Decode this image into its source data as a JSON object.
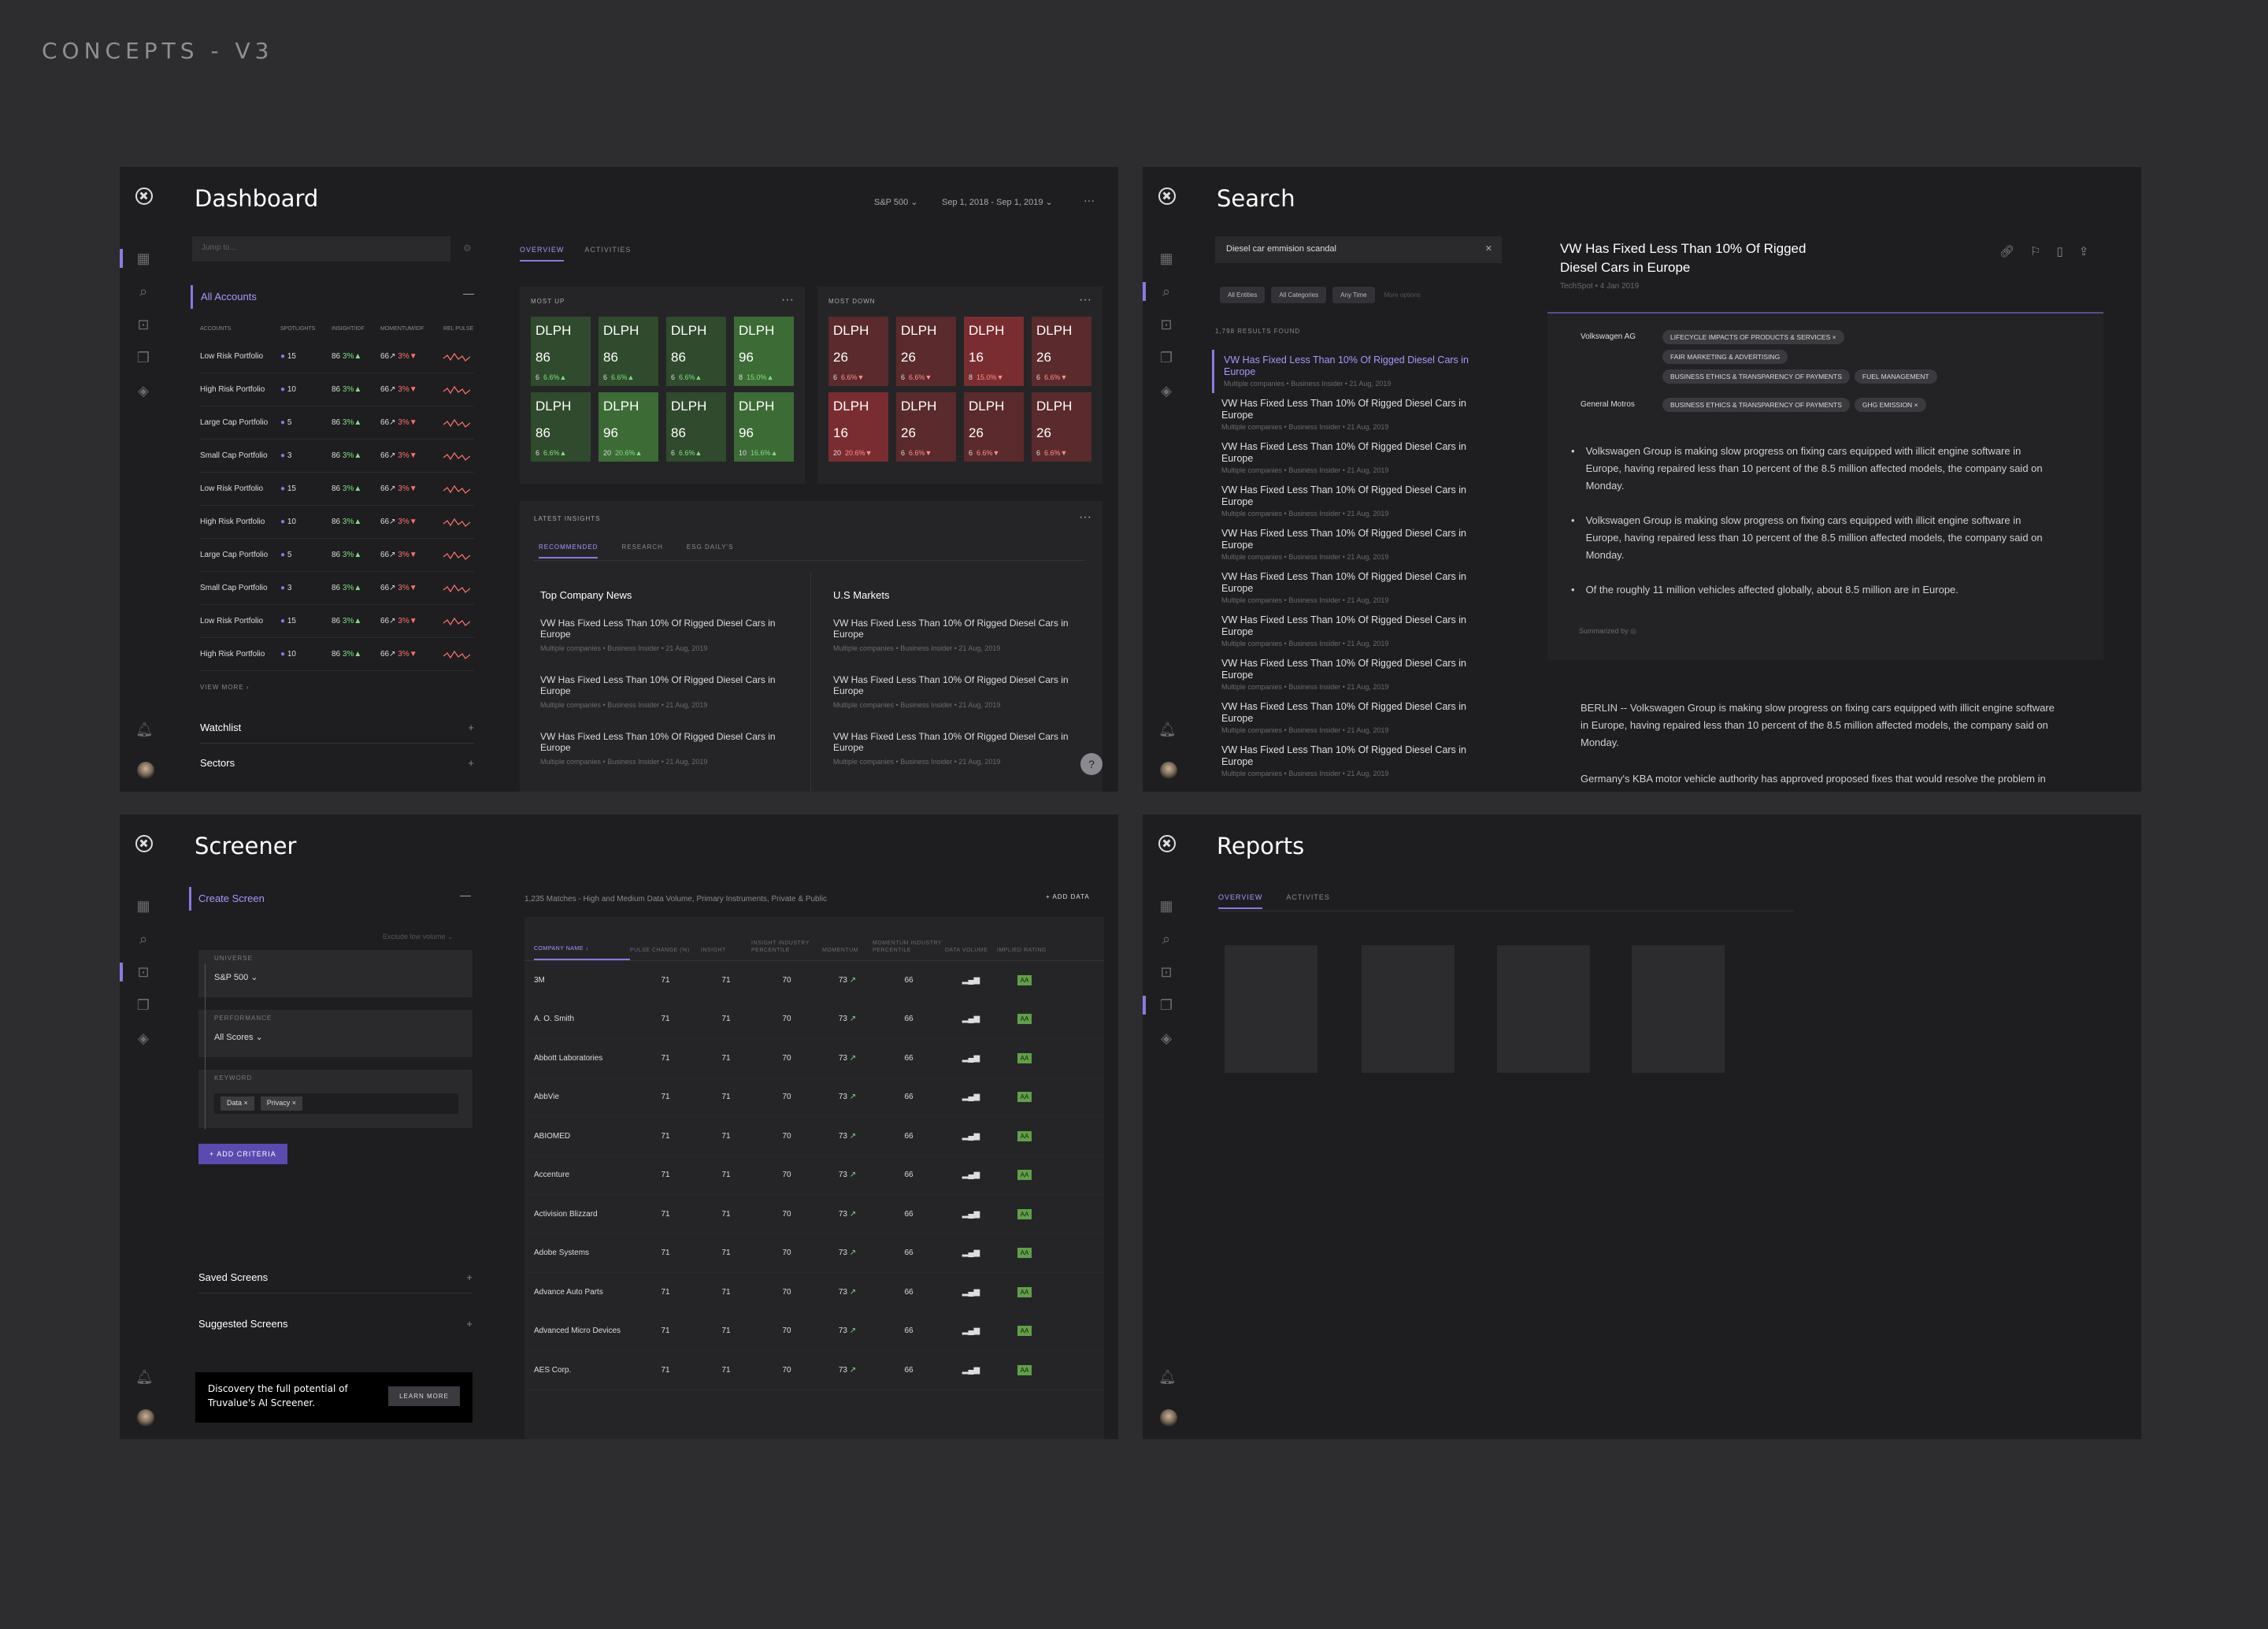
{
  "header": {
    "label": "CONCEPTS - V3"
  },
  "dashboard": {
    "title": "Dashboard",
    "index": "S&P 500",
    "date_range": "Sep 1, 2018 - Sep 1, 2019",
    "more": "···",
    "search_placeholder": "Jump to...",
    "all_accounts": "All Accounts",
    "columns": [
      "ACCOUNTS",
      "SPOTLIGHTS",
      "INSIGHT/IDF",
      "MOMENTUM/IDF",
      "REL PULSE"
    ],
    "accounts": [
      {
        "name": "Low Risk Portfolio",
        "spot": "15",
        "ins": "86",
        "insd": "3%",
        "mom": "66",
        "momd": "3%"
      },
      {
        "name": "High Risk Portfolio",
        "spot": "10",
        "ins": "86",
        "insd": "3%",
        "mom": "66",
        "momd": "3%"
      },
      {
        "name": "Large Cap Portfolio",
        "spot": "5",
        "ins": "86",
        "insd": "3%",
        "mom": "66",
        "momd": "3%"
      },
      {
        "name": "Small Cap Portfolio",
        "spot": "3",
        "ins": "86",
        "insd": "3%",
        "mom": "66",
        "momd": "3%"
      },
      {
        "name": "Low Risk Portfolio",
        "spot": "15",
        "ins": "86",
        "insd": "3%",
        "mom": "66",
        "momd": "3%"
      },
      {
        "name": "High Risk Portfolio",
        "spot": "10",
        "ins": "86",
        "insd": "3%",
        "mom": "66",
        "momd": "3%"
      },
      {
        "name": "Large Cap Portfolio",
        "spot": "5",
        "ins": "86",
        "insd": "3%",
        "mom": "66",
        "momd": "3%"
      },
      {
        "name": "Small Cap Portfolio",
        "spot": "3",
        "ins": "86",
        "insd": "3%",
        "mom": "66",
        "momd": "3%"
      },
      {
        "name": "Low Risk Portfolio",
        "spot": "15",
        "ins": "86",
        "insd": "3%",
        "mom": "66",
        "momd": "3%"
      },
      {
        "name": "High Risk Portfolio",
        "spot": "10",
        "ins": "86",
        "insd": "3%",
        "mom": "66",
        "momd": "3%"
      }
    ],
    "view_more": "VIEW MORE",
    "watchlist": "Watchlist",
    "sectors": "Sectors",
    "tabs": [
      "OVERVIEW",
      "ACTIVITIES"
    ],
    "most_up": "MOST UP",
    "most_down": "MOST DOWN",
    "up_tiles": [
      {
        "t": "DLPH",
        "v": "86",
        "a": "6",
        "p": "6.6%",
        "c": "#2f4a2c"
      },
      {
        "t": "DLPH",
        "v": "86",
        "a": "6",
        "p": "6.6%",
        "c": "#2f4a2c"
      },
      {
        "t": "DLPH",
        "v": "86",
        "a": "6",
        "p": "6.6%",
        "c": "#2f4a2c"
      },
      {
        "t": "DLPH",
        "v": "96",
        "a": "8",
        "p": "15.0%",
        "c": "#3c6b36"
      },
      {
        "t": "DLPH",
        "v": "86",
        "a": "6",
        "p": "6.6%",
        "c": "#2f4a2c"
      },
      {
        "t": "DLPH",
        "v": "96",
        "a": "20",
        "p": "20.6%",
        "c": "#3c6b36"
      },
      {
        "t": "DLPH",
        "v": "86",
        "a": "6",
        "p": "6.6%",
        "c": "#2f4a2c"
      },
      {
        "t": "DLPH",
        "v": "96",
        "a": "10",
        "p": "16.6%",
        "c": "#3c6b36"
      }
    ],
    "down_tiles": [
      {
        "t": "DLPH",
        "v": "26",
        "a": "6",
        "p": "6.6%",
        "c": "#5a2a2c"
      },
      {
        "t": "DLPH",
        "v": "26",
        "a": "6",
        "p": "6.6%",
        "c": "#5a2a2c"
      },
      {
        "t": "DLPH",
        "v": "16",
        "a": "8",
        "p": "15.0%",
        "c": "#7a2d30"
      },
      {
        "t": "DLPH",
        "v": "26",
        "a": "6",
        "p": "6.6%",
        "c": "#5a2a2c"
      },
      {
        "t": "DLPH",
        "v": "16",
        "a": "20",
        "p": "20.6%",
        "c": "#7a2d30"
      },
      {
        "t": "DLPH",
        "v": "26",
        "a": "6",
        "p": "6.6%",
        "c": "#5a2a2c"
      },
      {
        "t": "DLPH",
        "v": "26",
        "a": "6",
        "p": "6.6%",
        "c": "#5a2a2c"
      },
      {
        "t": "DLPH",
        "v": "26",
        "a": "6",
        "p": "6.6%",
        "c": "#5a2a2c"
      }
    ],
    "latest_insights": "LATEST INSIGHTS",
    "insight_tabs": [
      "RECOMMENDED",
      "RESEARCH",
      "ESG DAILY'S"
    ],
    "col1_title": "Top Company News",
    "col2_title": "U.S Markets",
    "news_title": "VW Has Fixed Less Than 10% Of Rigged Diesel Cars in Europe",
    "news_meta": "Multiple companies • Business Insider • 21 Aug, 2019",
    "help": "?"
  },
  "search": {
    "title": "Search",
    "query": "Diesel car emmision scandal",
    "filters": [
      "All Entities",
      "All Categories",
      "Any Time"
    ],
    "more_options": "More options",
    "results_count": "1,798 RESULTS FOUND",
    "result_title": "VW Has Fixed Less Than 10% Of Rigged Diesel Cars in Europe",
    "result_meta": "Multiple companies • Business Insider • 21 Aug, 2019",
    "detail_title": "VW Has Fixed Less Than 10% Of Rigged Diesel Cars in Europe",
    "detail_source": "TechSpot • 4 Jan 2019",
    "entity1": "Volkswagen AG",
    "entity1_tags": [
      "LIFECYCLE IMPACTS OF PRODUCTS & SERVICES",
      "FAIR MARKETING & ADVERTISING",
      "BUSINESS ETHICS & TRANSPARENCY OF PAYMENTS",
      "FUEL MANAGEMENT"
    ],
    "entity2": "General Motros",
    "entity2_tags": [
      "BUSINESS ETHICS & TRANSPARENCY OF PAYMENTS",
      "GHG EMISSION"
    ],
    "bullets": [
      "Volkswagen Group is making slow progress on fixing cars equipped with illicit engine software in Europe, having repaired less than 10 percent of the 8.5 million affected models, the company said on Monday.",
      "Volkswagen Group is making slow progress on fixing cars equipped with illicit engine software in Europe, having repaired less than 10 percent of the 8.5 million affected models, the company said on Monday.",
      "Of the roughly 11 million vehicles affected globally, about 8.5 million are in Europe."
    ],
    "summarized_by": "Summarized by",
    "body1": "BERLIN -- Volkswagen Group is making slow progress on fixing cars equipped with illicit engine software in Europe, having repaired less than 10 percent of the 8.5 million affected models, the company said on Monday.",
    "body2": "Germany's KBA motor vehicle authority has approved proposed fixes that would resolve the problem in"
  },
  "screener": {
    "title": "Screener",
    "create": "Create Screen",
    "exclude": "Exclude low volume",
    "universe_label": "UNIVERSE",
    "universe": "S&P 500",
    "performance_label": "PERFORMANCE",
    "performance": "All Scores",
    "keyword_label": "KEYWORD",
    "keywords": [
      "Data",
      "Privacy"
    ],
    "add_criteria": "ADD CRITERIA",
    "saved": "Saved Screens",
    "suggested": "Suggested Screens",
    "promo": "Discovery the full potential of Truvalue's AI Screener.",
    "learn_more": "LEARN MORE",
    "matches": "1,235 Matches - High and Medium Data Volume, Primary Instruments, Private & Public",
    "add_data": "ADD DATA",
    "headers": [
      "COMPANY NAME ↓",
      "PULSE CHANGE (%)",
      "INSIGHT",
      "INSIGHT INDUSTRY PERCENTILE",
      "MOMENTUM",
      "MOMENTUM INDUSTRY PERCENTILE",
      "DATA VOLUME",
      "IMPLIED RATING"
    ],
    "rows": [
      "3M",
      "A. O. Smith",
      "Abbott Laboratories",
      "AbbVie",
      "ABIOMED",
      "Accenture",
      "Activision Blizzard",
      "Adobe Systems",
      "Advance Auto Parts",
      "Advanced Micro Devices",
      "AES Corp."
    ],
    "pulse": "71",
    "insight": "71",
    "ins_pct": "70",
    "momentum": "73",
    "mom_pct": "66",
    "rating": "AA"
  },
  "reports": {
    "title": "Reports",
    "tabs": [
      "OVERVIEW",
      "ACTIVITES"
    ]
  },
  "colors": {
    "accent": "#8c78e0",
    "up": "#7ee07e",
    "down": "#ff7070"
  }
}
